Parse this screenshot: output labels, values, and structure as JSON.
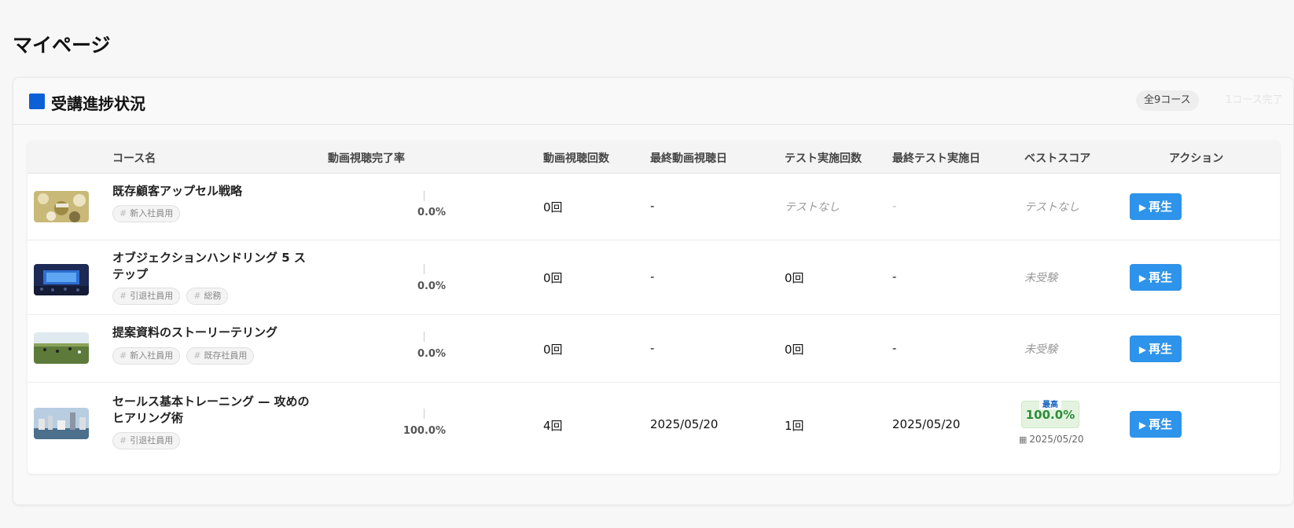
{
  "page": {
    "title": "マイページ"
  },
  "section": {
    "title": "受講進捗状況",
    "total_badge": "全9コース",
    "completed_badge": "1コース完了"
  },
  "columns": {
    "course": "コース名",
    "completion": "動画視聴完了率",
    "views": "動画視聴回数",
    "last_view": "最終動画視聴日",
    "test_count": "テスト実施回数",
    "last_test": "最終テスト実施日",
    "best_score": "ベストスコア",
    "action": "アクション"
  },
  "rows": [
    {
      "name": "既存顧客アップセル戦略",
      "tags": [
        "新入社員用"
      ],
      "completion": "0.0%",
      "completion_fraction": 0,
      "views": "0回",
      "last_view": "-",
      "test_count": "テストなし",
      "last_test": "-",
      "best": "テストなし",
      "action": "再生"
    },
    {
      "name": "オブジェクションハンドリング 5 ステップ",
      "tags": [
        "引退社員用",
        "総務"
      ],
      "completion": "0.0%",
      "completion_fraction": 0,
      "views": "0回",
      "last_view": "-",
      "test_count": "0回",
      "last_test": "-",
      "best": "未受験",
      "action": "再生"
    },
    {
      "name": "提案資料のストーリーテリング",
      "tags": [
        "新入社員用",
        "既存社員用"
      ],
      "completion": "0.0%",
      "completion_fraction": 0,
      "views": "0回",
      "last_view": "-",
      "test_count": "0回",
      "last_test": "-",
      "best": "未受験",
      "action": "再生"
    },
    {
      "name": "セールス基本トレーニング — 攻めのヒアリング術",
      "tags": [
        "引退社員用"
      ],
      "completion": "100.0%",
      "completion_fraction": 1,
      "views": "4回",
      "last_view": "2025/05/20",
      "test_count": "1回",
      "last_test": "2025/05/20",
      "best_label": "最高",
      "best_score": "100.0%",
      "best_date": "2025/05/20",
      "action": "再生"
    }
  ],
  "colors": {
    "accent": "#0d5fd6",
    "button": "#2e93ea",
    "score": "#2d8c3a"
  }
}
